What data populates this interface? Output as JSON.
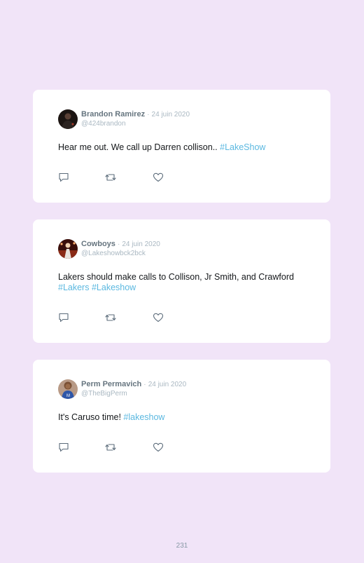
{
  "tweets": [
    {
      "name": "Brandon Ramirez",
      "date": "24 juin 2020",
      "handle": "@424brandon",
      "text": "Hear me out. We call up Darren collison.. ",
      "tags": [
        "#LakeShow"
      ]
    },
    {
      "name": "Cowboys",
      "date": "24 juin 2020",
      "handle": "@Lakeshowbck2bck",
      "text": "Lakers should make calls to Collison, Jr Smith, and Crawford ",
      "tags": [
        "#Lakers",
        "#Lakeshow"
      ]
    },
    {
      "name": "Perm Permavich",
      "date": "24 juin 2020",
      "handle": "@TheBigPerm",
      "text": "It's Caruso time! ",
      "tags": [
        "#lakeshow"
      ]
    }
  ],
  "separator": "·",
  "icons": [
    "reply-icon",
    "retweet-icon",
    "like-icon"
  ],
  "colors": {
    "background": "#f1e4f8",
    "card": "#ffffff",
    "hashtag": "#5bb8e0",
    "muted": "#aab8c2"
  },
  "page_number": "231"
}
